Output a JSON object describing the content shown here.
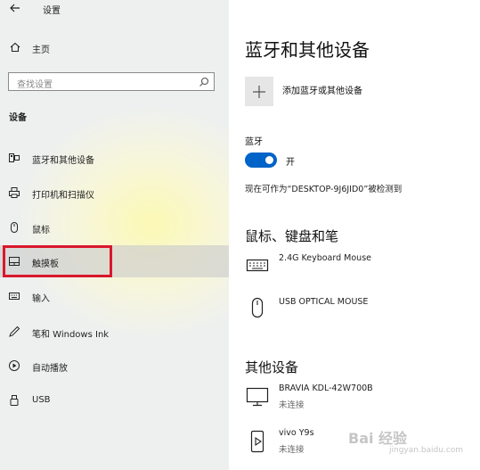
{
  "window": {
    "title": "设置"
  },
  "sidebar": {
    "home_label": "主页",
    "search_placeholder": "查找设置",
    "section_label": "设备",
    "items": [
      {
        "label": "蓝牙和其他设备",
        "icon": "bluetooth-devices-icon"
      },
      {
        "label": "打印机和扫描仪",
        "icon": "printer-icon"
      },
      {
        "label": "鼠标",
        "icon": "mouse-icon"
      },
      {
        "label": "触摸板",
        "icon": "touchpad-icon",
        "selected": true
      },
      {
        "label": "输入",
        "icon": "keyboard-icon"
      },
      {
        "label": "笔和 Windows Ink",
        "icon": "pen-icon"
      },
      {
        "label": "自动播放",
        "icon": "autoplay-icon"
      },
      {
        "label": "USB",
        "icon": "usb-icon"
      }
    ]
  },
  "main": {
    "title": "蓝牙和其他设备",
    "add_device_label": "添加蓝牙或其他设备",
    "bluetooth_label": "蓝牙",
    "bluetooth_state": "开",
    "discoverable_text": "现在可作为“DESKTOP-9J6JID0”被检测到",
    "mouse_section": {
      "title": "鼠标、键盘和笔",
      "devices": [
        {
          "name": "2.4G Keyboard Mouse",
          "icon": "keyboard-icon"
        },
        {
          "name": "USB OPTICAL MOUSE",
          "icon": "mouse-icon"
        }
      ]
    },
    "other_section": {
      "title": "其他设备",
      "devices": [
        {
          "name": "BRAVIA KDL-42W700B",
          "status": "未连接",
          "icon": "monitor-icon"
        },
        {
          "name": "vivo Y9s",
          "status": "未连接",
          "icon": "phone-icon"
        }
      ]
    }
  },
  "colors": {
    "accent": "#0063c8",
    "highlight": "#d9182d",
    "sidebar_bg": "#eef0f0"
  },
  "watermark": {
    "text": "Bai 经验",
    "sub": "jingyan.baidu.com"
  }
}
